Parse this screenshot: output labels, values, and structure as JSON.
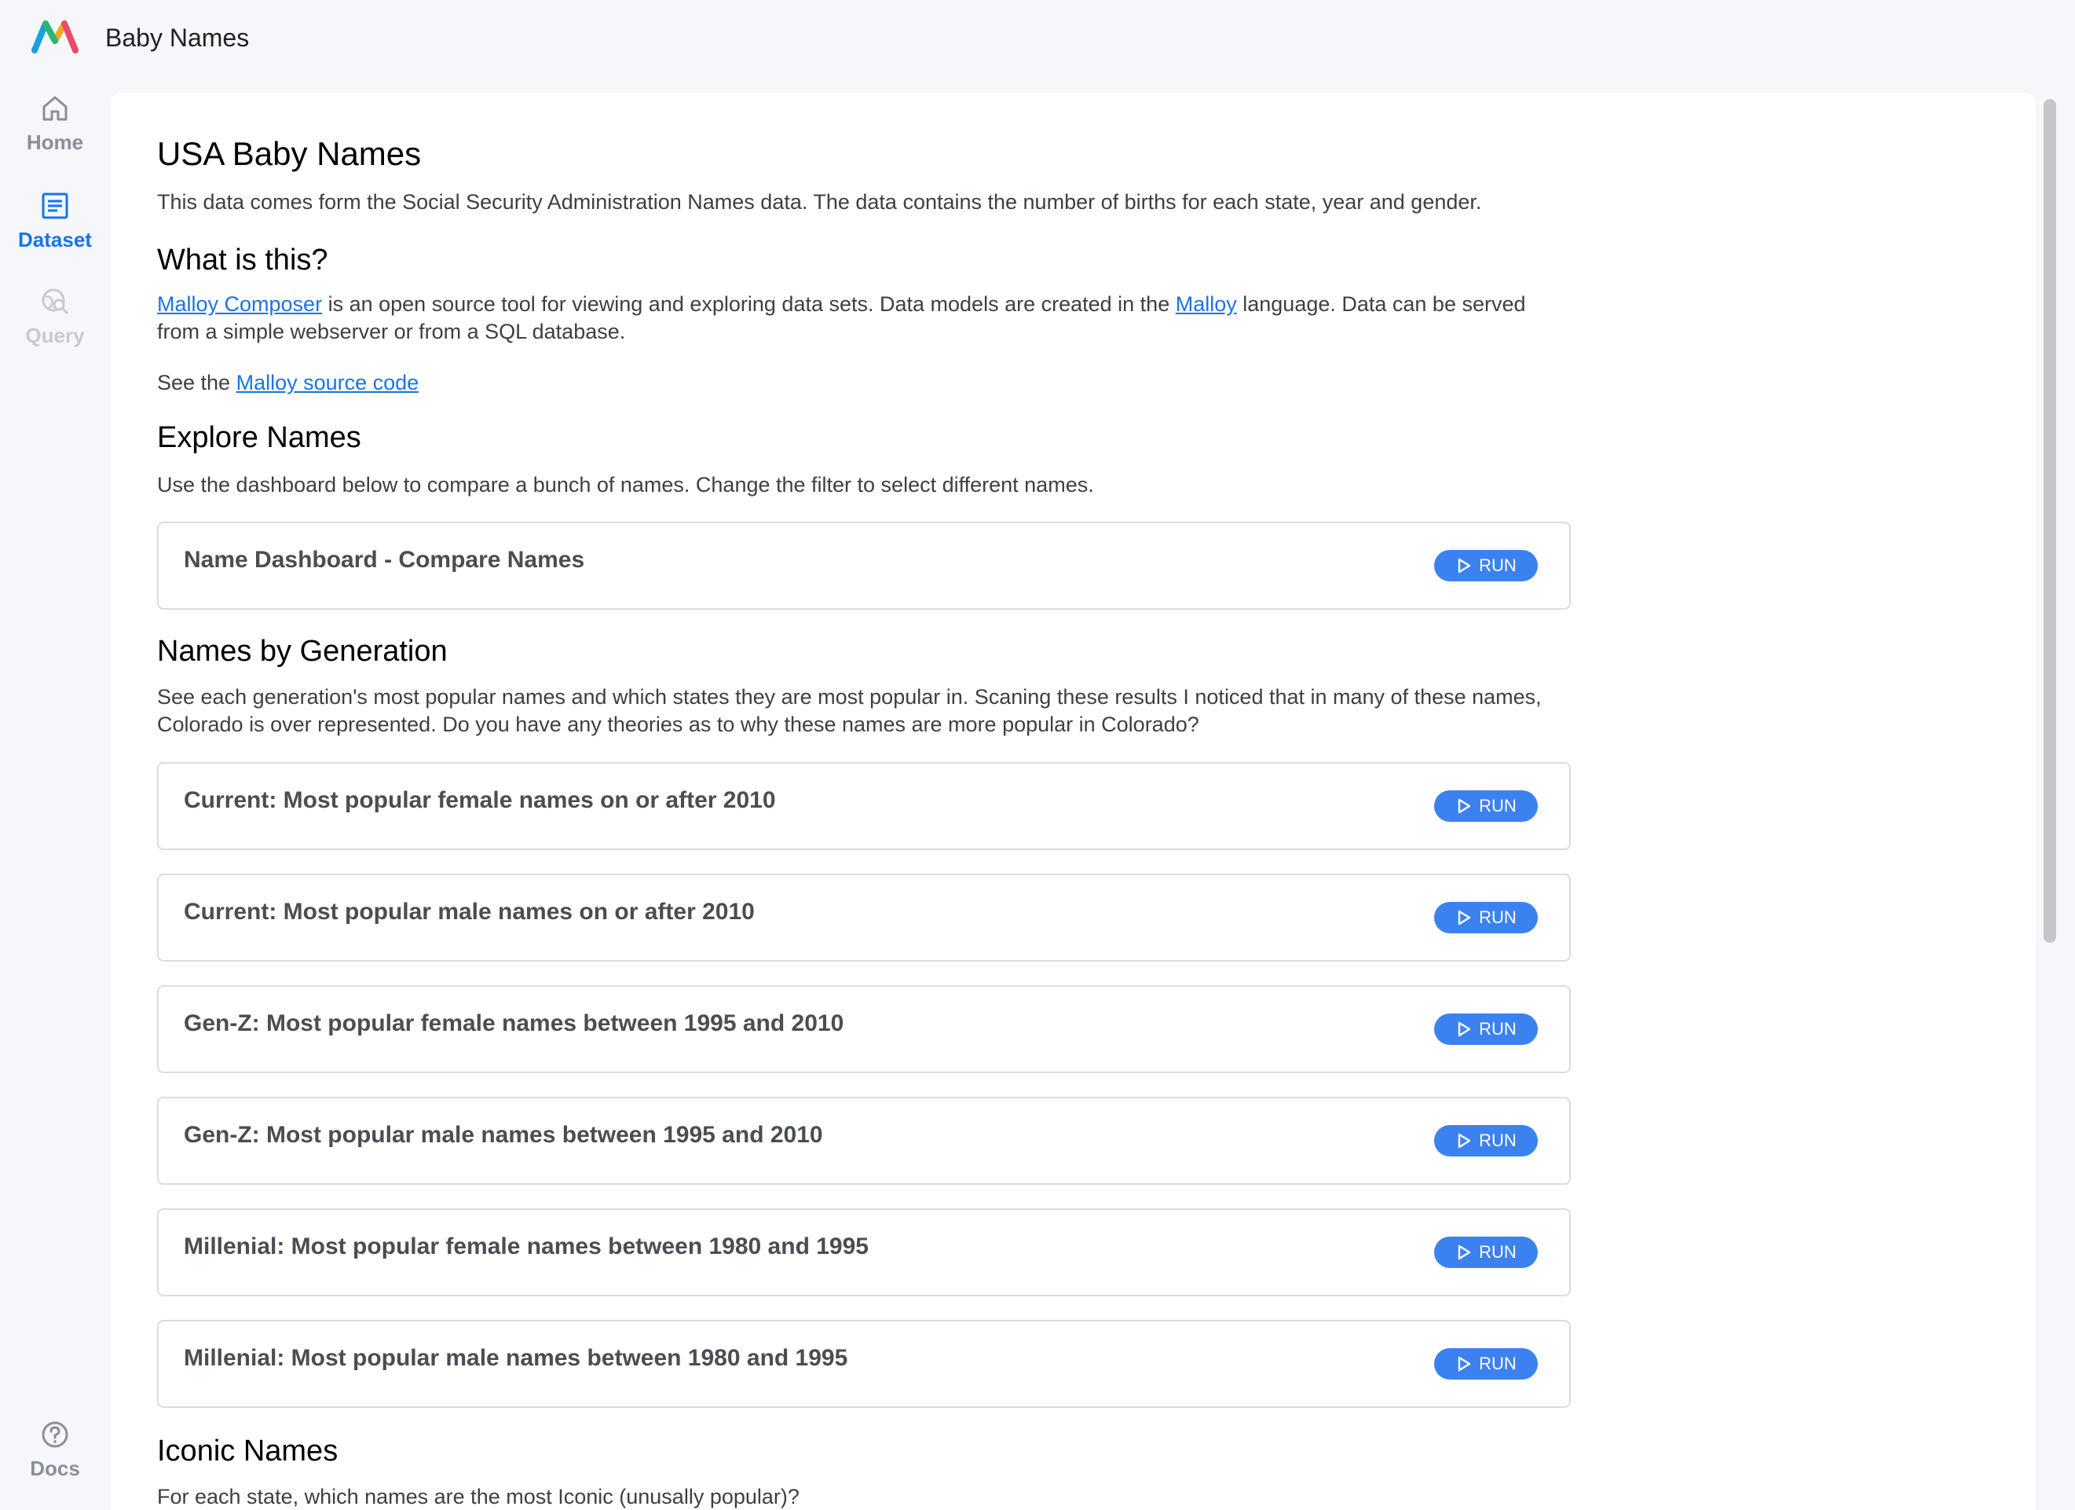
{
  "app": {
    "title": "Baby Names"
  },
  "nav": {
    "home": "Home",
    "dataset": "Dataset",
    "query": "Query",
    "docs": "Docs"
  },
  "page": {
    "title": "USA Baby Names",
    "intro": "This data comes form the Social Security Administration Names data. The data contains the number of births for each state, year and gender.",
    "what": {
      "heading": "What is this?",
      "link1": "Malloy Composer",
      "text1": " is an open source tool for viewing and exploring data sets. Data models are created in the ",
      "link2": "Malloy",
      "text2": " language. Data can be served from a simple webserver or from a SQL database.",
      "see_prefix": "See the ",
      "see_link": "Malloy source code"
    },
    "explore": {
      "heading": "Explore Names",
      "text": "Use the dashboard below to compare a bunch of names. Change the filter to select different names.",
      "cards": [
        {
          "title": "Name Dashboard - Compare Names",
          "button": "RUN"
        }
      ]
    },
    "generation": {
      "heading": "Names by Generation",
      "text": "See each generation's most popular names and which states they are most popular in. Scaning these results I noticed that in many of these names, Colorado is over represented. Do you have any theories as to why these names are more popular in Colorado?",
      "cards": [
        {
          "title": "Current: Most popular female names on or after 2010",
          "button": "RUN"
        },
        {
          "title": "Current: Most popular male names on or after 2010",
          "button": "RUN"
        },
        {
          "title": "Gen-Z: Most popular female names between 1995 and 2010",
          "button": "RUN"
        },
        {
          "title": "Gen-Z: Most popular male names between 1995 and 2010",
          "button": "RUN"
        },
        {
          "title": "Millenial: Most popular female names between 1980 and 1995",
          "button": "RUN"
        },
        {
          "title": "Millenial: Most popular male names between 1980 and 1995",
          "button": "RUN"
        }
      ]
    },
    "iconic": {
      "heading": "Iconic Names",
      "text": "For each state, which names are the most Iconic (unusally popular)?"
    }
  },
  "colors": {
    "accent": "#1a73e8",
    "button": "#3b82f0"
  }
}
